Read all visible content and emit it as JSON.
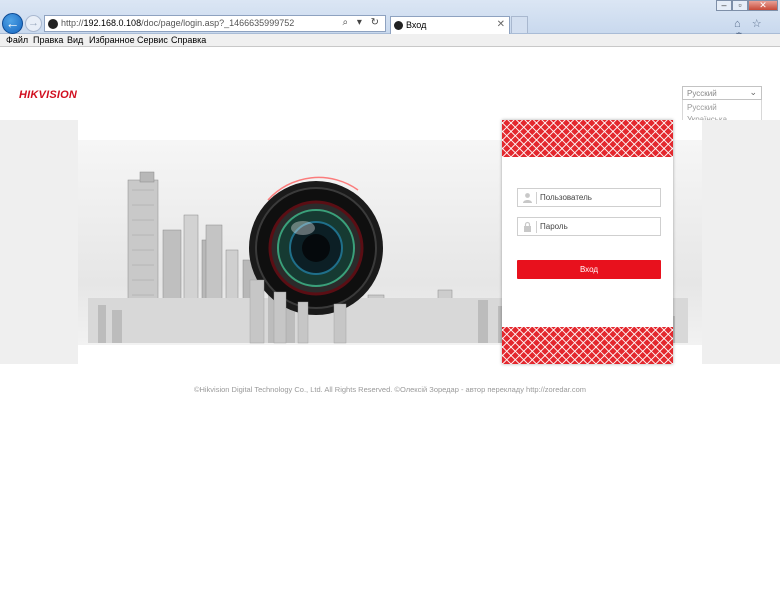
{
  "browser": {
    "url_prefix": "http://",
    "url_host": "192.168.0.108",
    "url_path": "/doc/page/login.asp?_1466635999752",
    "url_tools": "⌕ ▾ ↻",
    "tab_title": "Вход",
    "tab_close": "✕",
    "back_icon": "←",
    "forward_icon": "→",
    "window_min": "–",
    "window_max": "▫",
    "window_close": "✕",
    "toolbar_icons": "⌂ ☆ ⚙"
  },
  "menu": {
    "file": "Файл",
    "edit": "Правка",
    "view": "Вид",
    "favorites": "Избранное",
    "tools": "Сервис",
    "help": "Справка"
  },
  "page": {
    "logo": "HIKVISION",
    "language": {
      "selected": "Русский",
      "chevron": "⌄",
      "options": [
        "Русский",
        "Українська"
      ]
    },
    "login": {
      "username_placeholder": "Пользователь",
      "password_placeholder": "Пароль",
      "submit_label": "Вход"
    },
    "footer": "©Hikvision Digital Technology Co., Ltd. All Rights Reserved. ©Олексій Зоредар - автор перекладу http://zoredar.com"
  },
  "colors": {
    "brand_red": "#e8111d",
    "logo_red": "#d10e1e",
    "pattern_red": "#e3282e"
  }
}
